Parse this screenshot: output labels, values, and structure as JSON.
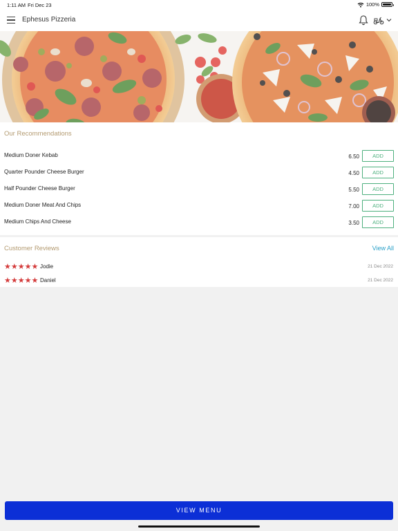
{
  "status_bar": {
    "time": "1:11 AM",
    "date": "Fri Dec 23",
    "battery": "100%"
  },
  "app_bar": {
    "title": "Ephesus Pizzeria",
    "icons": [
      "menu-icon",
      "bell-icon",
      "scooter-icon",
      "chevron-down-icon"
    ]
  },
  "recommendations": {
    "title": "Our Recommendations",
    "items": [
      {
        "name": "Medium Doner Kebab",
        "price": "6.50",
        "action": "ADD"
      },
      {
        "name": "Quarter Pounder Cheese Burger",
        "price": "4.50",
        "action": "ADD"
      },
      {
        "name": "Half Pounder Cheese Burger",
        "price": "5.50",
        "action": "ADD"
      },
      {
        "name": "Medium Doner Meat And Chips",
        "price": "7.00",
        "action": "ADD"
      },
      {
        "name": "Medium Chips And Cheese",
        "price": "3.50",
        "action": "ADD"
      }
    ]
  },
  "reviews": {
    "title": "Customer Reviews",
    "view_all": "View All",
    "items": [
      {
        "name": "Jodie",
        "rating": 5,
        "date": "21 Dec 2022"
      },
      {
        "name": "Daniel",
        "rating": 5,
        "date": "21 Dec 2022"
      }
    ]
  },
  "view_menu_label": "VIEW MENU",
  "colors": {
    "accent_gold": "#b39a70",
    "add_green": "#4caf7d",
    "star_red": "#d43b3b",
    "link_blue": "#2aa0c8",
    "primary_button": "#0c2fd6"
  }
}
